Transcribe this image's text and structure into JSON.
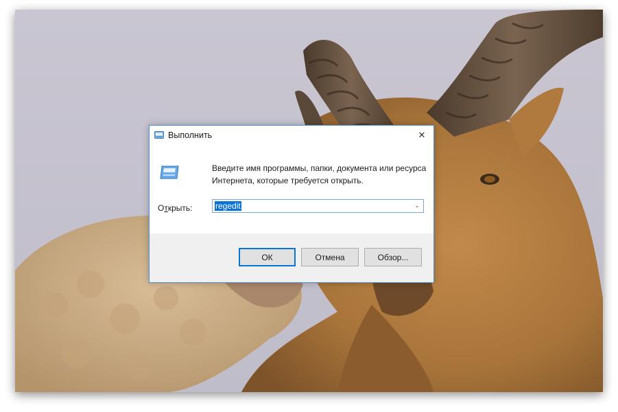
{
  "dialog": {
    "title": "Выполнить",
    "description_line1": "Введите имя программы, папки, документа или ресурса",
    "description_line2": "Интернета, которые требуется открыть.",
    "open_label_prefix": "О",
    "open_label_underlined": "т",
    "open_label_suffix": "крыть:",
    "input_value": "regedit",
    "close_glyph": "✕",
    "dropdown_glyph": "⌄",
    "buttons": {
      "ok": "ОК",
      "cancel": "Отмена",
      "browse": "Обзор..."
    }
  },
  "icons": {
    "title": "run-icon",
    "content": "run-program-icon",
    "close": "close-icon",
    "dropdown": "chevron-down-icon"
  },
  "colors": {
    "accent": "#0a74d6",
    "dialog_border": "#4a90d9",
    "footer_bg": "#f0f0f0",
    "button_bg": "#e1e1e1"
  }
}
